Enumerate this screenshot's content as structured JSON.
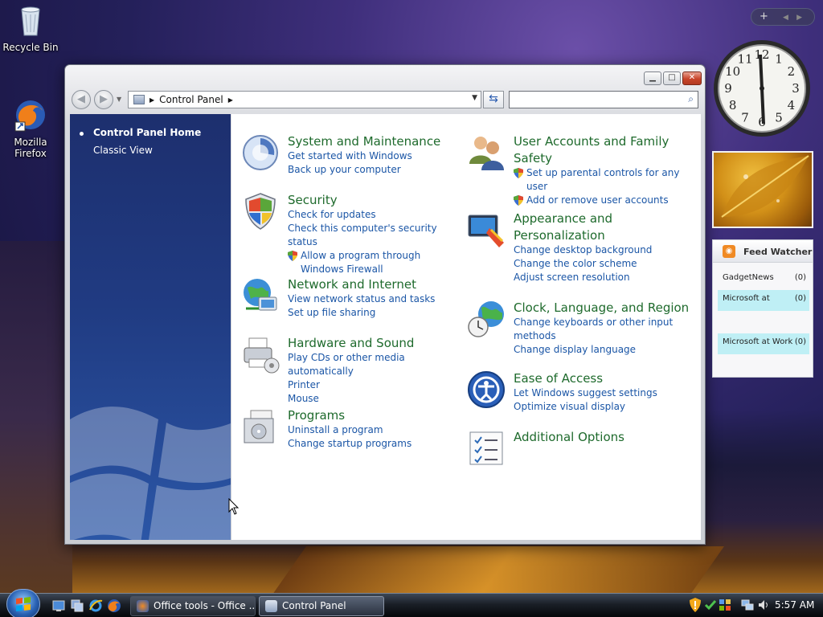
{
  "desktop": {
    "icons": [
      {
        "label": "Recycle Bin",
        "icon": "recycle-bin-icon"
      },
      {
        "label": "Mozilla\nFirefox",
        "icon": "firefox-icon"
      }
    ]
  },
  "window": {
    "address": {
      "path": "Control Panel"
    },
    "search": {
      "placeholder": ""
    },
    "controls": {
      "minimize": "minimize-icon",
      "maximize": "maximize-icon",
      "close": "close-icon"
    }
  },
  "nav": {
    "items": [
      {
        "label": "Control Panel Home",
        "selected": true
      },
      {
        "label": "Classic View",
        "selected": false
      }
    ]
  },
  "categories": {
    "left": [
      {
        "title": "System and Maintenance",
        "icon": "system-maintenance-icon",
        "links": [
          "Get started with Windows",
          "Back up your computer"
        ]
      },
      {
        "title": "Security",
        "icon": "security-shield-icon",
        "links": [
          "Check for updates",
          "Check this computer's security status",
          "Allow a program through Windows Firewall"
        ]
      },
      {
        "title": "Network and Internet",
        "icon": "network-globe-icon",
        "links": [
          "View network status and tasks",
          "Set up file sharing"
        ]
      },
      {
        "title": "Hardware and Sound",
        "icon": "hardware-printer-icon",
        "links": [
          "Play CDs or other media automatically",
          "Printer",
          "Mouse"
        ]
      },
      {
        "title": "Programs",
        "icon": "programs-box-icon",
        "links": [
          "Uninstall a program",
          "Change startup programs"
        ]
      }
    ],
    "right": [
      {
        "title": "User Accounts and Family Safety",
        "icon": "user-accounts-icon",
        "links": [
          "Set up parental controls for any user",
          "Add or remove user accounts"
        ]
      },
      {
        "title": "Appearance and Personalization",
        "icon": "appearance-monitor-icon",
        "links": [
          "Change desktop background",
          "Change the color scheme",
          "Adjust screen resolution"
        ]
      },
      {
        "title": "Clock, Language, and Region",
        "icon": "clock-globe-icon",
        "links": [
          "Change keyboards or other input methods",
          "Change display language"
        ]
      },
      {
        "title": "Ease of Access",
        "icon": "ease-of-access-icon",
        "links": [
          "Let Windows suggest settings",
          "Optimize visual display"
        ]
      },
      {
        "title": "Additional Options",
        "icon": "additional-options-icon",
        "links": []
      }
    ]
  },
  "sidebar": {
    "feed": {
      "title": "Feed Watcher",
      "rows": [
        {
          "name": "GadgetNews",
          "count": "(0)"
        },
        {
          "name": "Microsoft at",
          "count": "(0)"
        },
        {
          "name": "Microsoft at Work",
          "count": "(0)"
        }
      ]
    },
    "clock_numbers": [
      "12",
      "1",
      "2",
      "3",
      "4",
      "5",
      "6",
      "7",
      "8",
      "9",
      "10",
      "11"
    ]
  },
  "taskbar": {
    "buttons": [
      {
        "label": "Office tools - Office ...",
        "icon": "firefox-icon"
      },
      {
        "label": "Control Panel",
        "icon": "control-panel-icon"
      }
    ],
    "time": "5:57 AM"
  },
  "colors": {
    "title_green": "#1e6a2c",
    "link_blue": "#1b56a6",
    "nav_blue": "#203b82"
  }
}
